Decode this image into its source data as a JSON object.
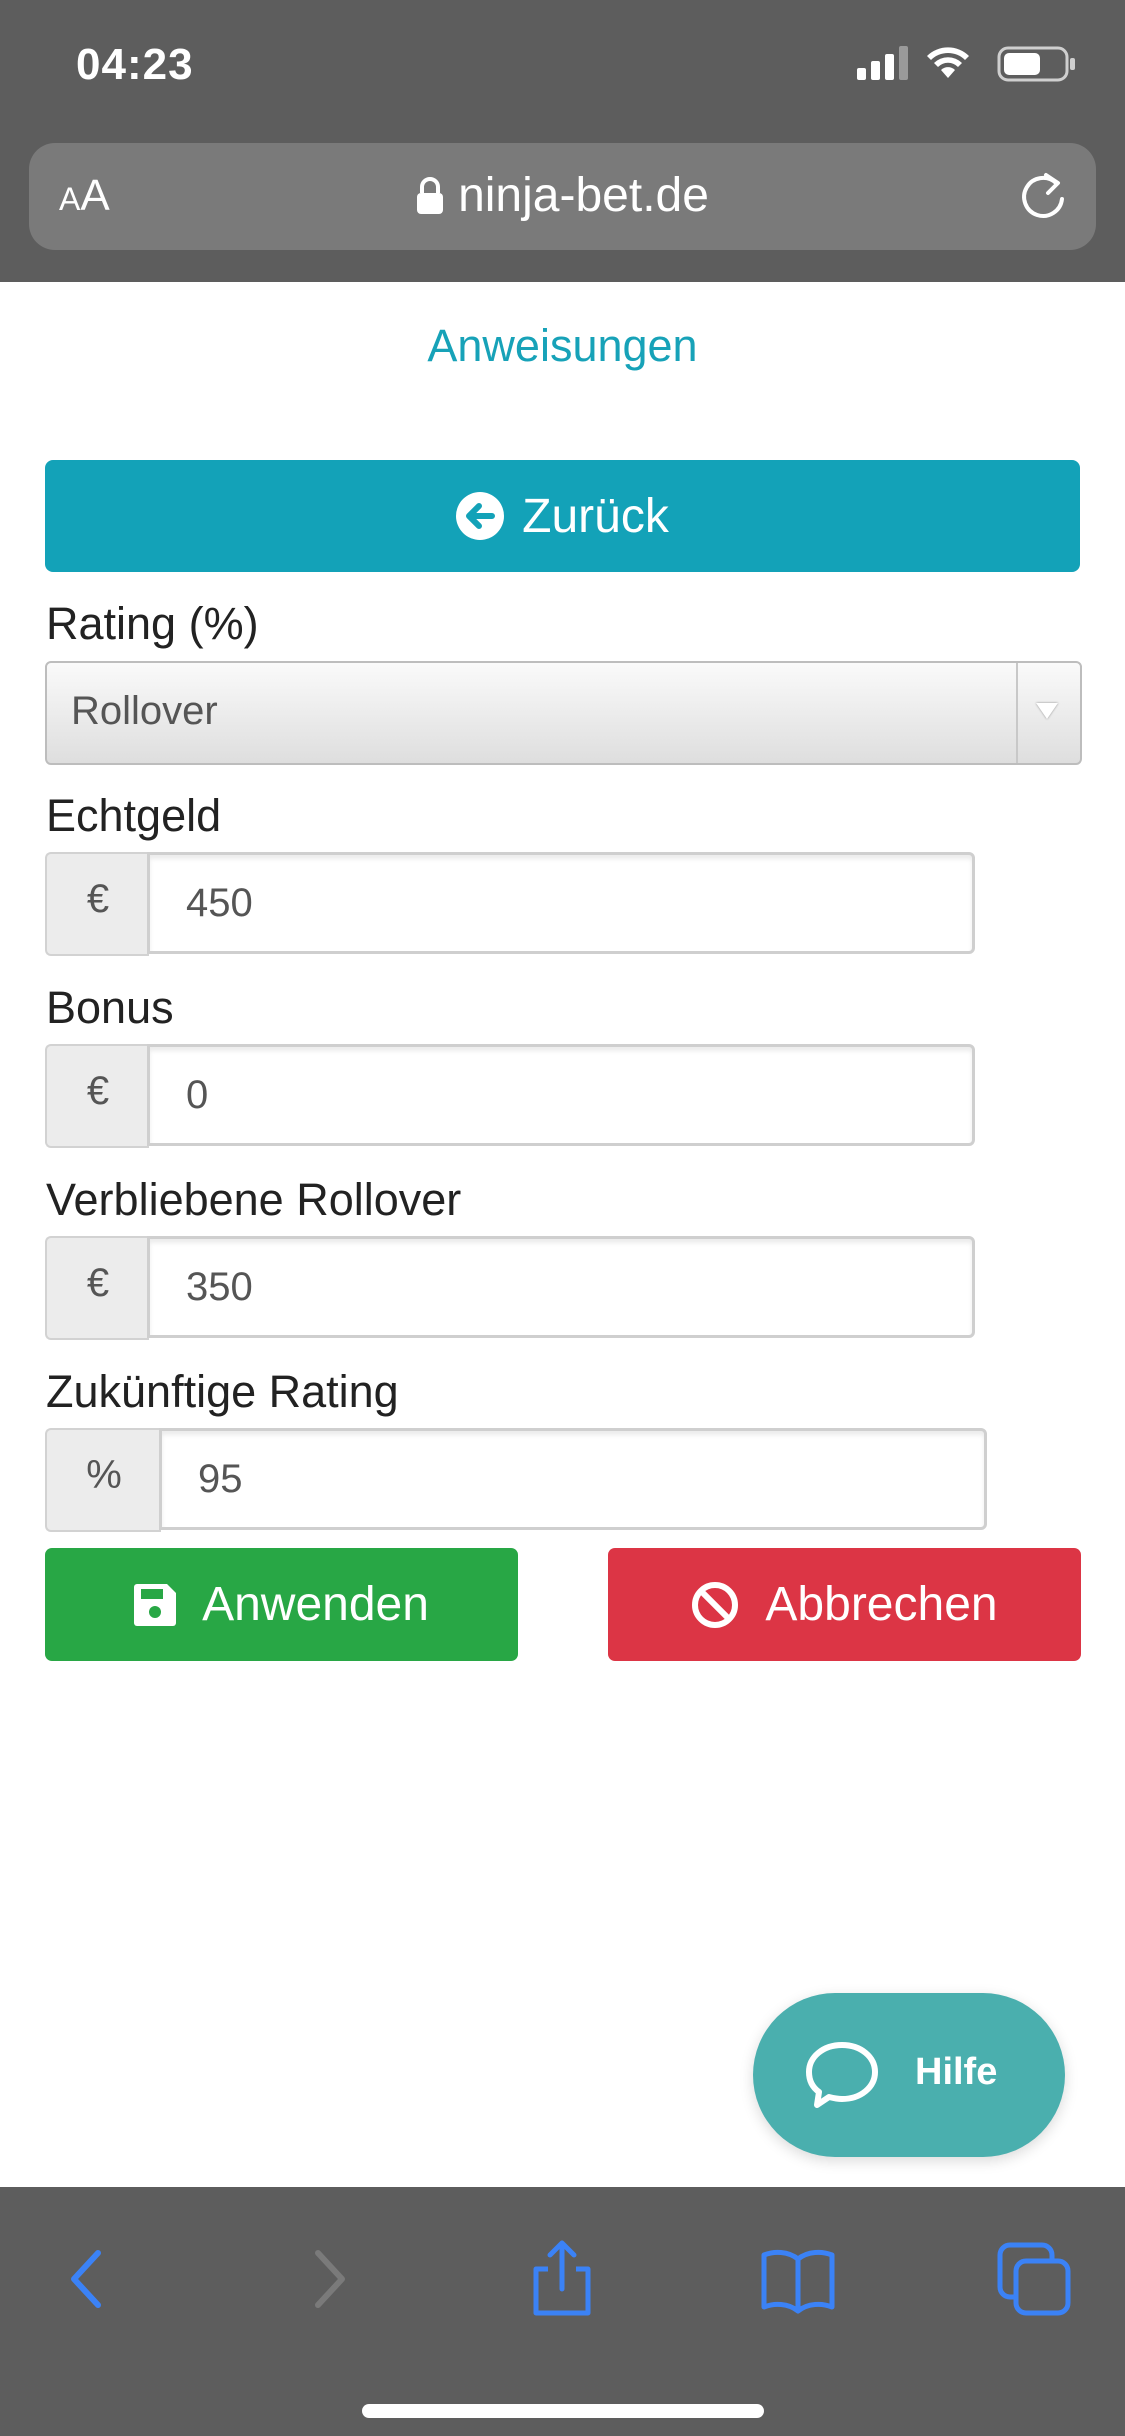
{
  "status_bar": {
    "time": "04:23",
    "icons": [
      "cellular-signal-icon",
      "wifi-icon",
      "battery-icon"
    ]
  },
  "browser": {
    "aa_label_small": "A",
    "aa_label_large": "A",
    "url": "ninja-bet.de",
    "url_icon": "lock-icon",
    "reload_icon": "reload-icon",
    "toolbar": [
      "back-icon",
      "forward-icon",
      "share-icon",
      "bookmarks-icon",
      "tabs-icon"
    ]
  },
  "page": {
    "instructions_link": "Anweisungen",
    "back_button": "Zurück",
    "rating_label": "Rating (%)",
    "rating_select_value": "Rollover",
    "fields": {
      "echtgeld": {
        "label": "Echtgeld",
        "addon": "€",
        "value": "450"
      },
      "bonus": {
        "label": "Bonus",
        "addon": "€",
        "value": "0"
      },
      "rollover": {
        "label": "Verbliebene Rollover",
        "addon": "€",
        "value": "350"
      },
      "future_rating": {
        "label": "Zukünftige Rating",
        "addon": "%",
        "value": "95"
      }
    },
    "apply_button": "Anwenden",
    "cancel_button": "Abbrechen",
    "help_button": "Hilfe"
  },
  "colors": {
    "link": "#17a2b8",
    "back_button": "#13a2b8",
    "apply_button": "#28a745",
    "cancel_button": "#dc3545",
    "help_button": "#4aafae",
    "toolbar_icon": "#3b82f6"
  }
}
